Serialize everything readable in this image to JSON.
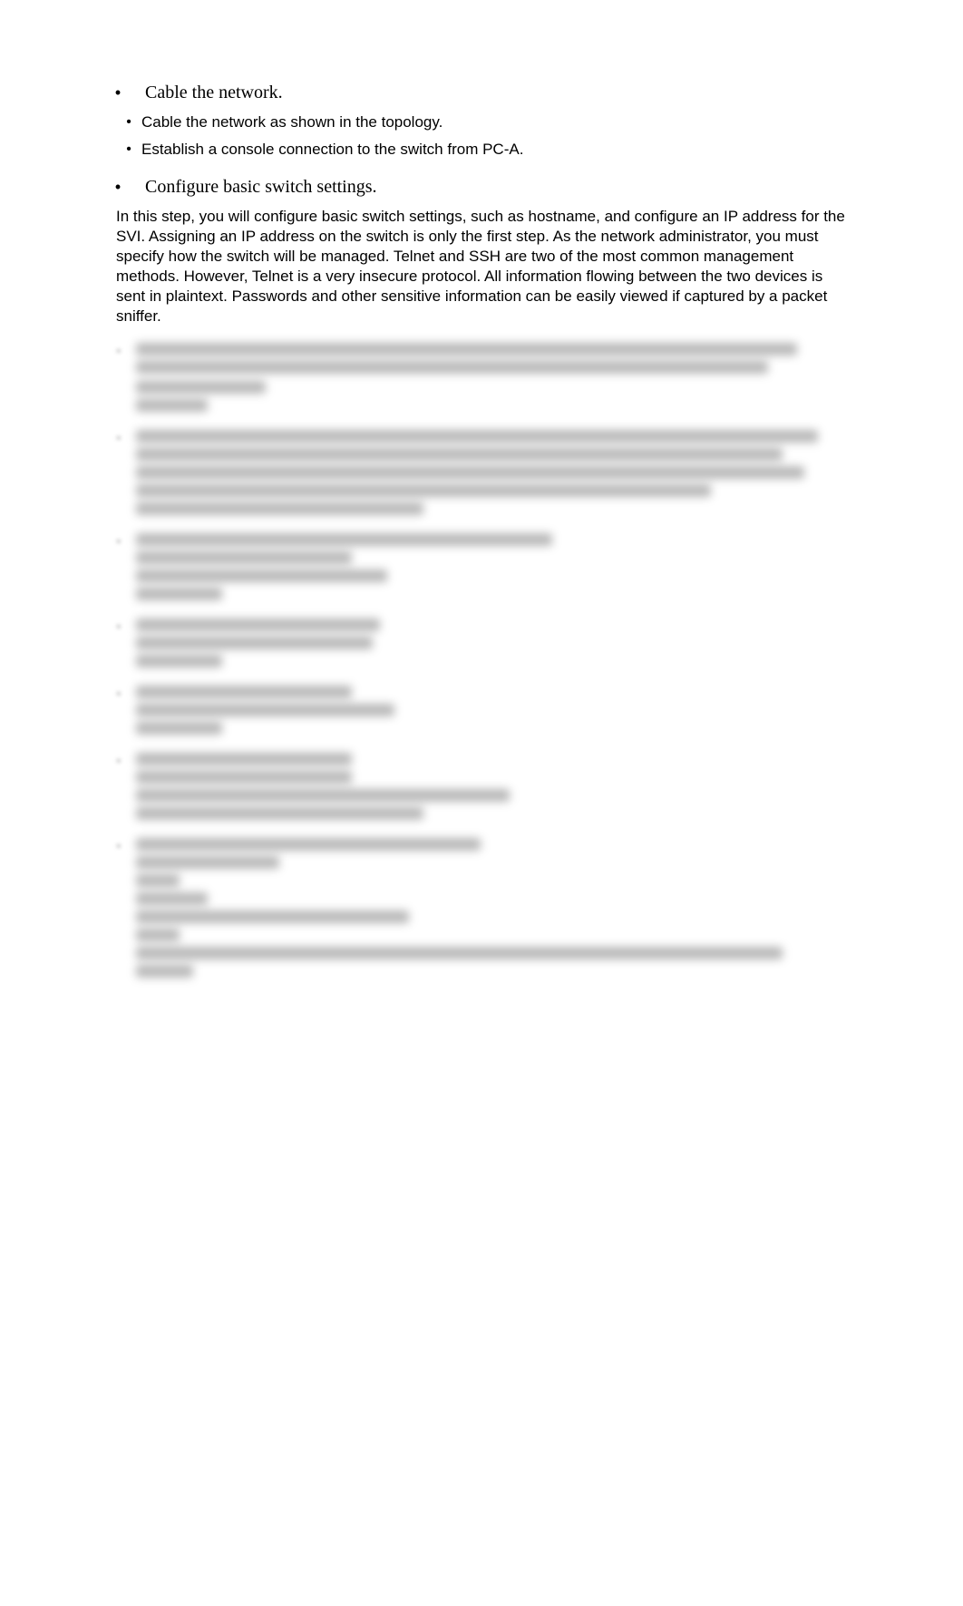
{
  "sections": [
    {
      "heading": "Cable the network.",
      "subitems": [
        "Cable the network as shown in the topology.",
        "Establish a console connection to the switch from PC-A."
      ]
    },
    {
      "heading": "Configure basic switch settings.",
      "paragraph": "In this step, you will configure basic switch settings, such as hostname, and configure an IP address for the SVI. Assigning an IP address on the switch is only the first step. As the network administrator, you must specify how the switch will be managed. Telnet and SSH are two of the most common management methods. However, Telnet is a very insecure protocol. All information flowing between the two devices is sent in plaintext. Passwords and other sensitive information can be easily viewed if captured by a packet sniffer."
    }
  ]
}
